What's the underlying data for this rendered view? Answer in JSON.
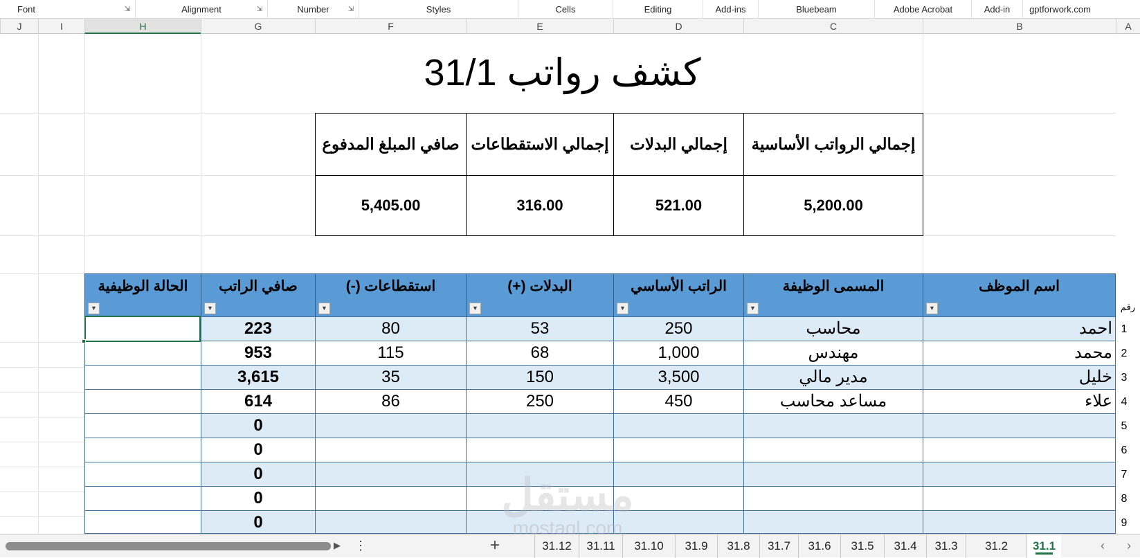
{
  "ribbon": {
    "groups": [
      "Font",
      "Alignment",
      "Number",
      "Styles",
      "Cells",
      "Editing",
      "Add-ins",
      "Bluebeam",
      "Adobe Acrobat",
      "Add-in",
      "gptforwork.com"
    ]
  },
  "columns": [
    "J",
    "I",
    "H",
    "G",
    "F",
    "E",
    "D",
    "C",
    "B",
    "A"
  ],
  "sheet": {
    "title": "كشف رواتب 31/1",
    "summary": {
      "headers": [
        "صافي المبلغ المدفوع",
        "إجمالي الاستقطاعات",
        "إجمالي البدلات",
        "إجمالي الرواتب الأساسية"
      ],
      "values": [
        "5,405.00",
        "316.00",
        "521.00",
        "5,200.00"
      ]
    },
    "table": {
      "row_no_header": "رقم",
      "headers": {
        "status": "الحالة الوظيفية",
        "net": "صافي الراتب",
        "deductions": "استقطاعات (-)",
        "allowances": "البدلات (+)",
        "basic": "الراتب الأساسي",
        "job": "المسمى الوظيفة",
        "name": "اسم الموظف"
      },
      "rows": [
        {
          "no": "1",
          "name": "احمد",
          "job": "محاسب",
          "basic": "250",
          "allowances": "53",
          "deductions": "80",
          "net": "223",
          "status": ""
        },
        {
          "no": "2",
          "name": "محمد",
          "job": "مهندس",
          "basic": "1,000",
          "allowances": "68",
          "deductions": "115",
          "net": "953",
          "status": ""
        },
        {
          "no": "3",
          "name": "خليل",
          "job": "مدير مالي",
          "basic": "3,500",
          "allowances": "150",
          "deductions": "35",
          "net": "3,615",
          "status": ""
        },
        {
          "no": "4",
          "name": "علاء",
          "job": "مساعد محاسب",
          "basic": "450",
          "allowances": "250",
          "deductions": "86",
          "net": "614",
          "status": ""
        },
        {
          "no": "5",
          "name": "",
          "job": "",
          "basic": "",
          "allowances": "",
          "deductions": "",
          "net": "0",
          "status": ""
        },
        {
          "no": "6",
          "name": "",
          "job": "",
          "basic": "",
          "allowances": "",
          "deductions": "",
          "net": "0",
          "status": ""
        },
        {
          "no": "7",
          "name": "",
          "job": "",
          "basic": "",
          "allowances": "",
          "deductions": "",
          "net": "0",
          "status": ""
        },
        {
          "no": "8",
          "name": "",
          "job": "",
          "basic": "",
          "allowances": "",
          "deductions": "",
          "net": "0",
          "status": ""
        },
        {
          "no": "9",
          "name": "",
          "job": "",
          "basic": "",
          "allowances": "",
          "deductions": "",
          "net": "0",
          "status": ""
        }
      ]
    }
  },
  "watermark": {
    "arabic": "مستقل",
    "latin": "mostaql.com"
  },
  "tabs": [
    "31.12",
    "31.11",
    "31.10",
    "31.9",
    "31.8",
    "31.7",
    "31.6",
    "31.5",
    "31.4",
    "31.3",
    "31.2",
    "31.1"
  ],
  "active_tab": "31.1",
  "icons": {
    "add_sheet": "plus-icon",
    "more": "vertical-ellipsis-icon",
    "prev": "chevron-left-icon",
    "next": "chevron-right-icon",
    "filter": "dropdown-arrow-icon",
    "launcher": "dialog-launcher-icon"
  },
  "colors": {
    "header_blue": "#5b9bd5",
    "band_blue": "#ddebf7",
    "excel_green": "#217346"
  }
}
